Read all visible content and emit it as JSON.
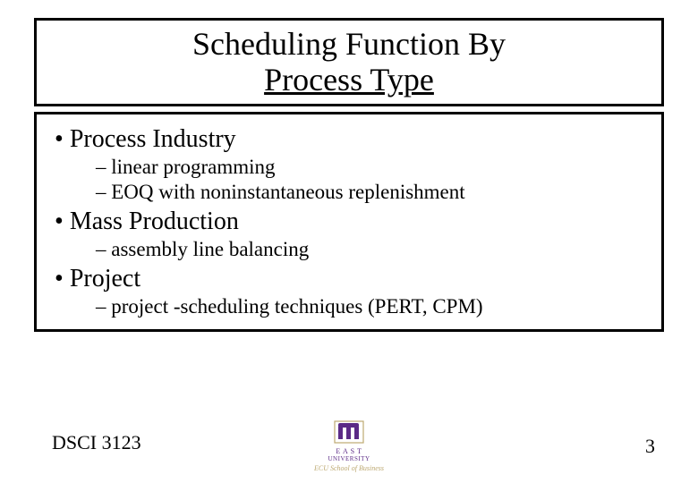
{
  "title": {
    "line1": "Scheduling Function By",
    "line2": "Process Type"
  },
  "content": {
    "items": [
      {
        "label": "Process Industry",
        "subitems": [
          "linear programming",
          "EOQ with noninstantaneous replenishment"
        ]
      },
      {
        "label": "Mass Production",
        "subitems": [
          "assembly line balancing"
        ]
      },
      {
        "label": "Project",
        "subitems": [
          "project -scheduling techniques (PERT, CPM)"
        ]
      }
    ]
  },
  "footer": {
    "course": "DSCI 3123",
    "page": "3",
    "logo": {
      "banner": "E A S T",
      "university": "UNIVERSITY",
      "school": "ECU School of Business",
      "color_primary": "#5b2a86",
      "color_accent": "#bda972"
    }
  }
}
